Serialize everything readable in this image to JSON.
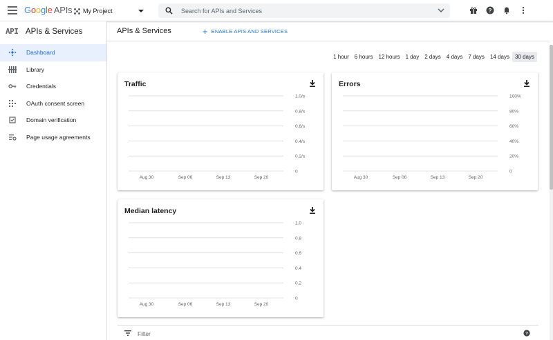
{
  "header": {
    "logo_parts": [
      "G",
      "o",
      "o",
      "g",
      "l",
      "e"
    ],
    "logo_suffix": "APIs",
    "project": "My Project",
    "search_placeholder": "Search for APIs and Services",
    "icons": [
      "gift-icon",
      "help-icon",
      "notifications-icon",
      "more-vert-icon"
    ]
  },
  "sidebar": {
    "badge": "API",
    "title": "APIs & Services",
    "items": [
      {
        "label": "Dashboard",
        "icon": "dashboard-icon",
        "active": true
      },
      {
        "label": "Library",
        "icon": "library-icon",
        "active": false
      },
      {
        "label": "Credentials",
        "icon": "key-icon",
        "active": false
      },
      {
        "label": "OAuth consent screen",
        "icon": "oauth-icon",
        "active": false
      },
      {
        "label": "Domain verification",
        "icon": "checkbox-icon",
        "active": false
      },
      {
        "label": "Page usage agreements",
        "icon": "settings-list-icon",
        "active": false
      }
    ]
  },
  "main": {
    "title": "APIs & Services",
    "enable_label": "ENABLE APIS AND SERVICES",
    "ranges": [
      "1 hour",
      "6 hours",
      "12 hours",
      "1 day",
      "2 days",
      "4 days",
      "7 days",
      "14 days",
      "30 days"
    ],
    "selected_range": "30 days",
    "filter_label": "Filter"
  },
  "chart_data": [
    {
      "type": "line",
      "title": "Traffic",
      "x_ticks": [
        "Aug 30",
        "Sep 06",
        "Sep 13",
        "Sep 20"
      ],
      "y_ticks": [
        "1.0/s",
        "0.8/s",
        "0.6/s",
        "0.4/s",
        "0.2/s",
        "0"
      ],
      "ylim": [
        0,
        1.0
      ],
      "grid": true,
      "series": []
    },
    {
      "type": "line",
      "title": "Errors",
      "x_ticks": [
        "Aug 30",
        "Sep 06",
        "Sep 13",
        "Sep 20"
      ],
      "y_ticks": [
        "100%",
        "80%",
        "60%",
        "40%",
        "20%",
        "0"
      ],
      "ylim": [
        0,
        100
      ],
      "grid": true,
      "series": []
    },
    {
      "type": "line",
      "title": "Median latency",
      "x_ticks": [
        "Aug 30",
        "Sep 06",
        "Sep 13",
        "Sep 20"
      ],
      "y_ticks": [
        "1.0",
        "0.8",
        "0.6",
        "0.4",
        "0.2",
        "0"
      ],
      "ylim": [
        0,
        1.0
      ],
      "grid": true,
      "series": []
    }
  ]
}
